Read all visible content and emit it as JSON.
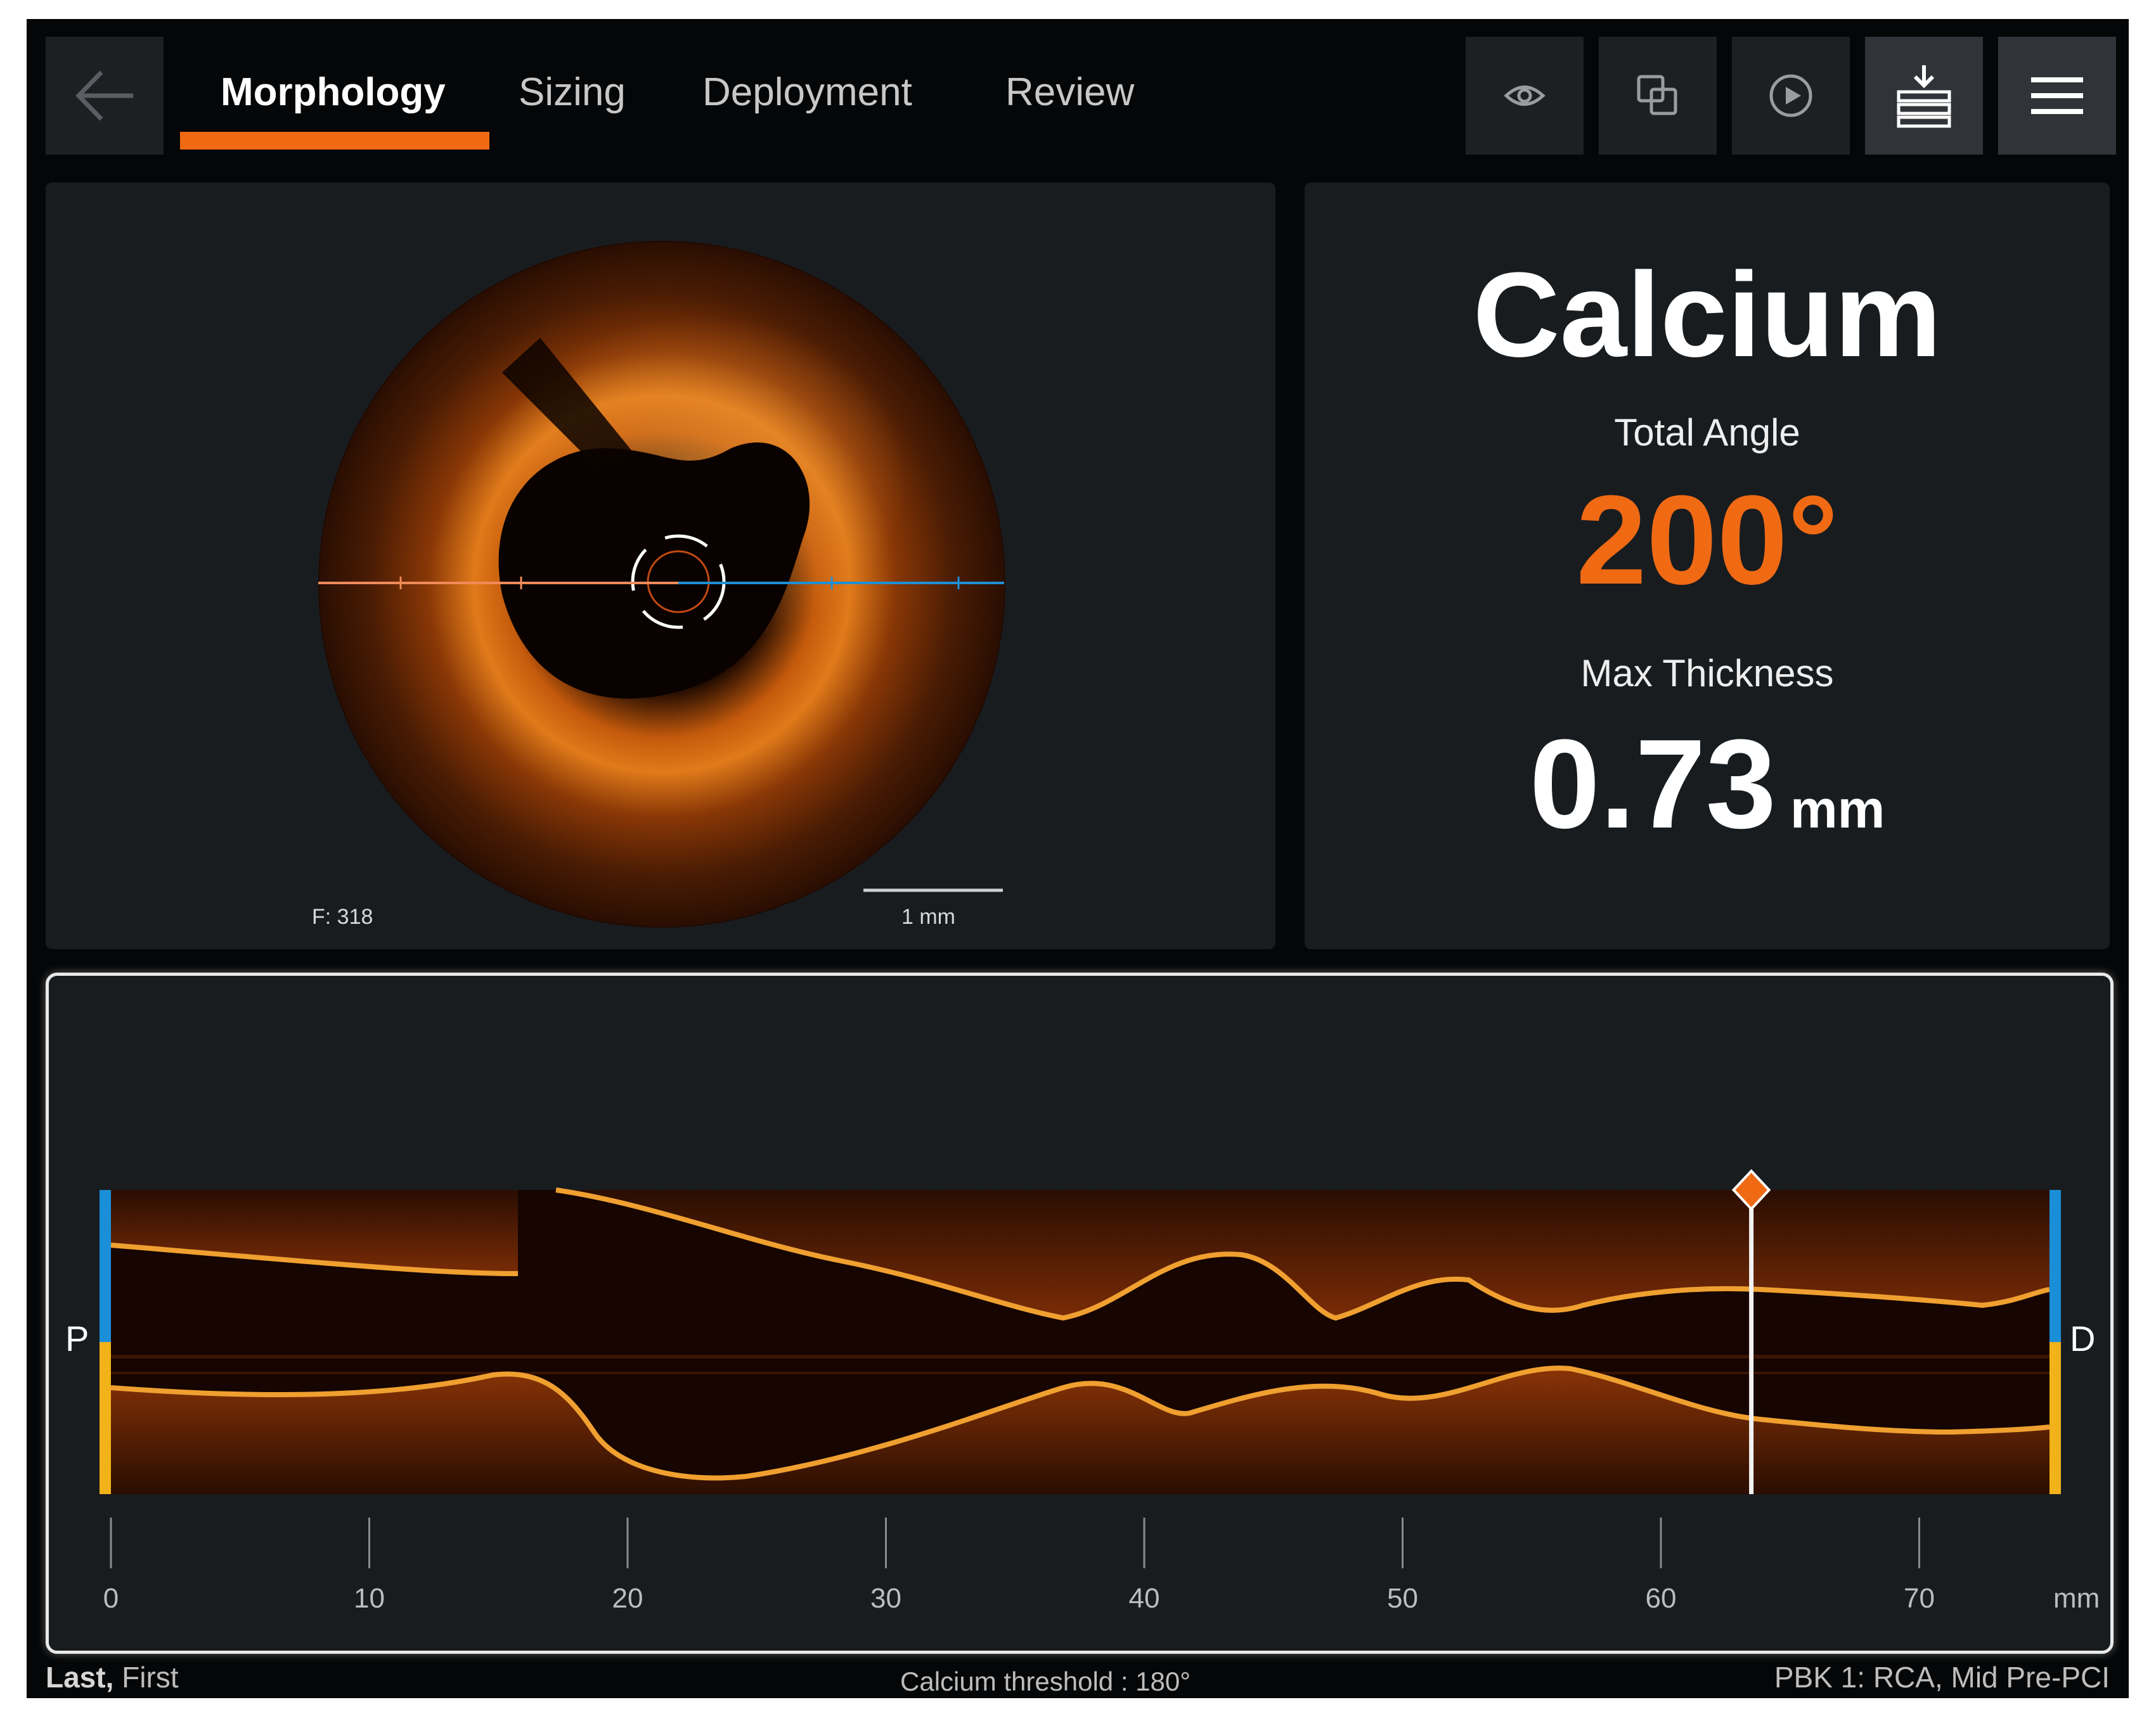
{
  "nav": {
    "back_icon": "arrow-left-icon",
    "tabs": [
      {
        "label": "Morphology",
        "active": true
      },
      {
        "label": "Sizing",
        "active": false
      },
      {
        "label": "Deployment",
        "active": false
      },
      {
        "label": "Review",
        "active": false
      }
    ],
    "tools": [
      "eye-icon",
      "copy-layers-icon",
      "play-icon",
      "download-tray-icon",
      "menu-icon"
    ]
  },
  "oct_image": {
    "frame_label": "F: 318",
    "scale_label": "1 mm"
  },
  "calcium": {
    "title": "Calcium",
    "total_angle_label": "Total Angle",
    "total_angle_value": "200°",
    "max_thickness_label": "Max Thickness",
    "max_thickness_value": "0.73",
    "max_thickness_unit": "mm",
    "accent_color": "#f06a14"
  },
  "longitudinal": {
    "proximal_label": "P",
    "distal_label": "D",
    "axis_ticks": [
      "0",
      "10",
      "20",
      "30",
      "40",
      "50",
      "60",
      "70"
    ],
    "axis_unit": "mm",
    "marker_position_mm": 63.5
  },
  "footer": {
    "patient_last": "Last,",
    "patient_first": "First",
    "threshold": "Calcium threshold : 180°",
    "pullback": "PBK 1:  RCA,  Mid Pre-PCI"
  }
}
